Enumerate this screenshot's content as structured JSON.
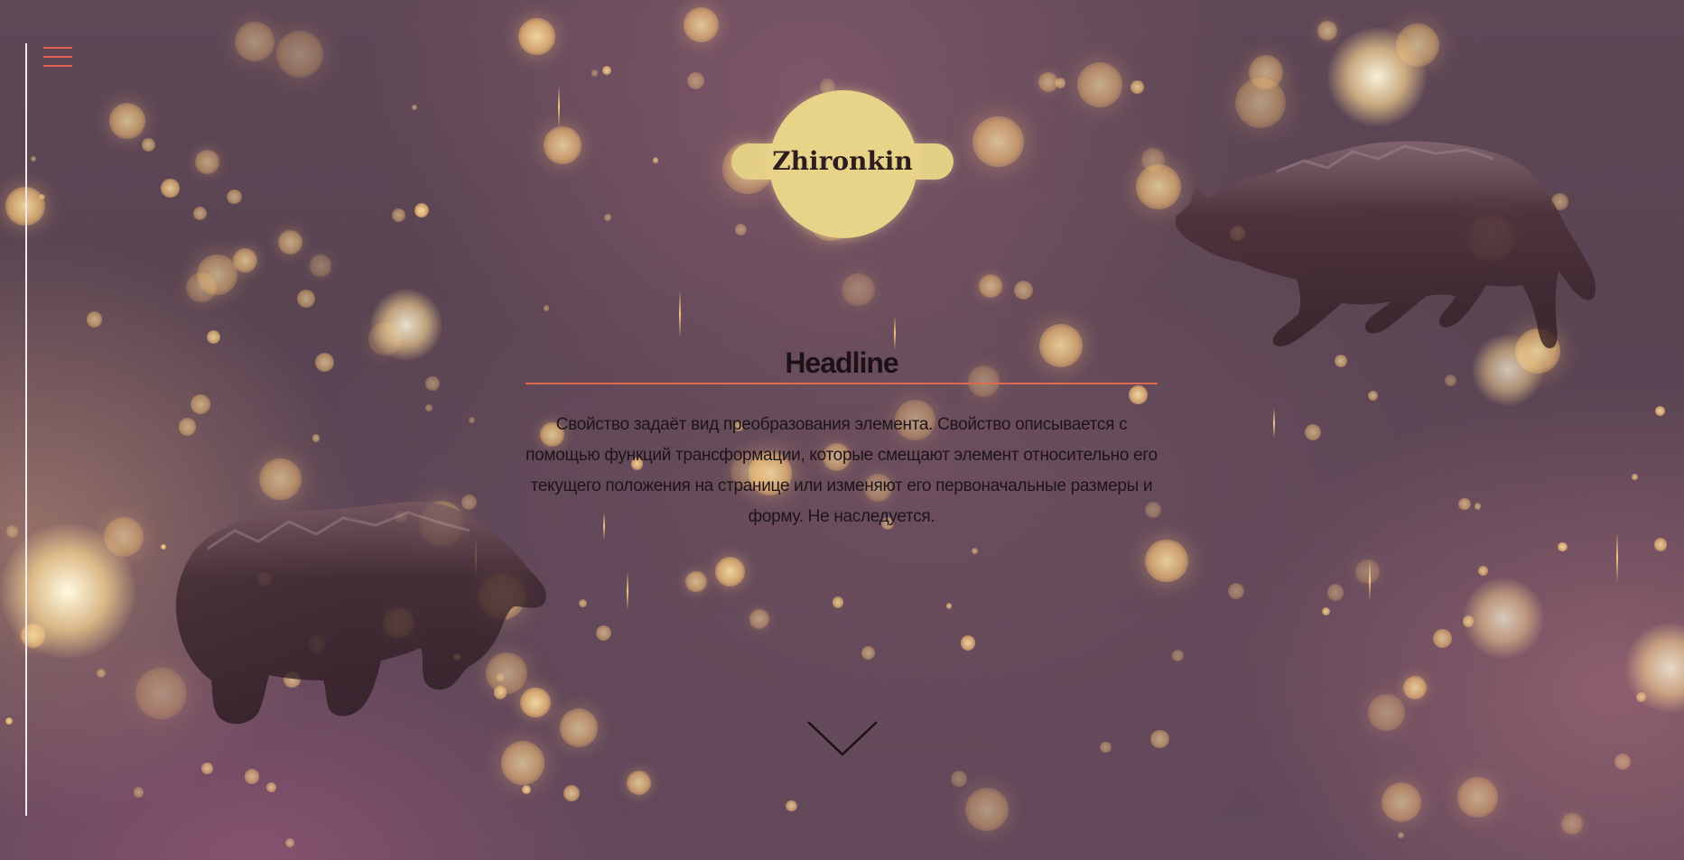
{
  "header": {
    "menu_icon": "hamburger-menu-icon",
    "logo": {
      "text": "Zhironkin"
    }
  },
  "main": {
    "headline": "Headline",
    "description": "Свойство задаёт вид преобразования элемента. Свойство описывается с помощью функций трансформации, которые смещают элемент относительно его текущего положения на странице или изменяют его первоначальные размеры и форму. Не наследуется."
  },
  "scroll_down": {
    "icon": "chevron-down-icon"
  },
  "decorations": {
    "left_figure": "bear-silhouette",
    "right_figure": "wolf-silhouette"
  },
  "colors": {
    "accent": "#e0614a",
    "logo_fill": "#e7d489",
    "text_dark": "#1c1216",
    "background": "#5c4556"
  }
}
